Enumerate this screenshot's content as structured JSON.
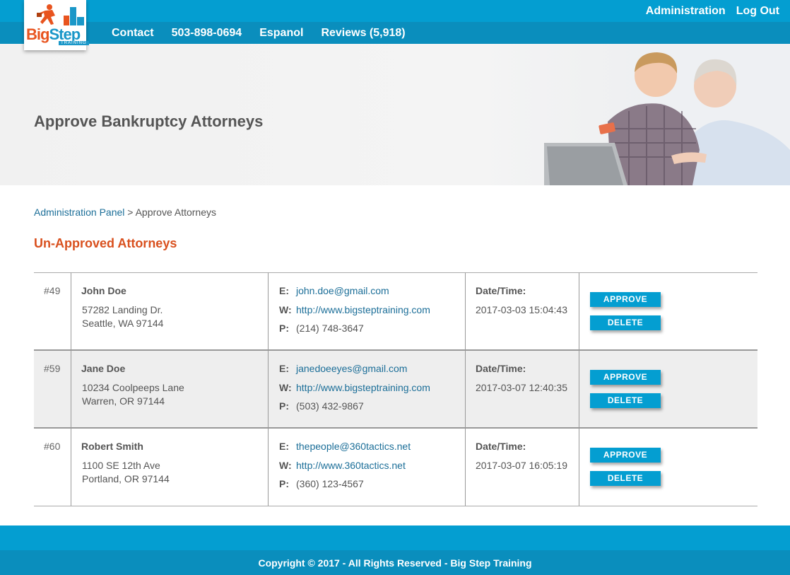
{
  "logo": {
    "word1": "Big",
    "word2": "Step",
    "sub": "TRAINING"
  },
  "top_links": {
    "admin": "Administration",
    "logout": "Log Out"
  },
  "nav": [
    "Contact",
    "503-898-0694",
    "Espanol",
    "Reviews (5,918)"
  ],
  "hero": {
    "title": "Approve Bankruptcy Attorneys"
  },
  "breadcrumb": {
    "link": "Administration Panel",
    "separator": " > ",
    "current": "Approve Attorneys"
  },
  "section_title": "Un-Approved Attorneys",
  "labels": {
    "email": "E:",
    "web": "W:",
    "phone": "P:",
    "datetime": "Date/Time:",
    "approve": "APPROVE",
    "delete": "DELETE"
  },
  "attorneys": [
    {
      "num": "#49",
      "name": "John Doe",
      "addr1": "57282 Landing Dr.",
      "addr2": "Seattle, WA 97144",
      "email": "john.doe@gmail.com",
      "web": "http://www.bigsteptraining.com",
      "phone": "(214) 748-3647",
      "datetime": "2017-03-03 15:04:43"
    },
    {
      "num": "#59",
      "name": "Jane Doe",
      "addr1": "10234 Coolpeeps Lane",
      "addr2": "Warren, OR 97144",
      "email": "janedoeeyes@gmail.com",
      "web": "http://www.bigsteptraining.com",
      "phone": "(503) 432-9867",
      "datetime": "2017-03-07 12:40:35"
    },
    {
      "num": "#60",
      "name": "Robert Smith",
      "addr1": "1100 SE 12th Ave",
      "addr2": "Portland, OR 97144",
      "email": "thepeople@360tactics.net",
      "web": "http://www.360tactics.net",
      "phone": "(360) 123-4567",
      "datetime": "2017-03-07 16:05:19"
    }
  ],
  "footer": {
    "copyright": "Copyright © 2017 - All Rights Reserved - Big Step Training"
  },
  "colors": {
    "primary": "#049ed1",
    "primary_dark": "#0a8ebd",
    "heading_accent": "#d9501e",
    "link": "#1b6e98"
  }
}
